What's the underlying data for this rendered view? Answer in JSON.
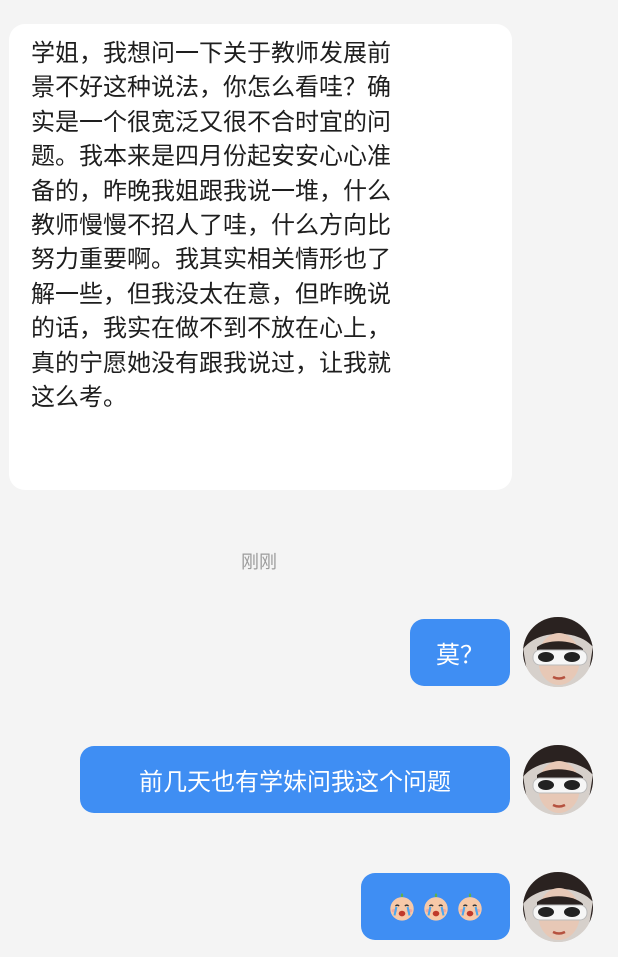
{
  "conversation": {
    "incoming_message": {
      "text": "学姐，我想问一下关于教师发展前\n景不好这种说法，你怎么看哇？确\n实是一个很宽泛又很不合时宜的问\n题。我本来是四月份起安安心心准\n备的，昨晚我姐跟我说一堆，什么\n教师慢慢不招人了哇，什么方向比\n努力重要啊。我其实相关情形也了\n解一些，但我没太在意，但昨晚说\n的话，我实在做不到不放在心上，\n真的宁愿她没有跟我说过，让我就\n这么考。"
    },
    "timestamp": "刚刚",
    "outgoing_messages": [
      {
        "text": "莫？"
      },
      {
        "text": "前几天也有学妹问我这个问题"
      },
      {
        "emoji": [
          "crying-face-emoji",
          "crying-face-emoji",
          "crying-face-emoji"
        ]
      }
    ]
  },
  "colors": {
    "background": "#f4f4f4",
    "incoming_bubble": "#ffffff",
    "outgoing_bubble": "#3f8ef3",
    "timestamp_text": "#9b9b9b"
  }
}
